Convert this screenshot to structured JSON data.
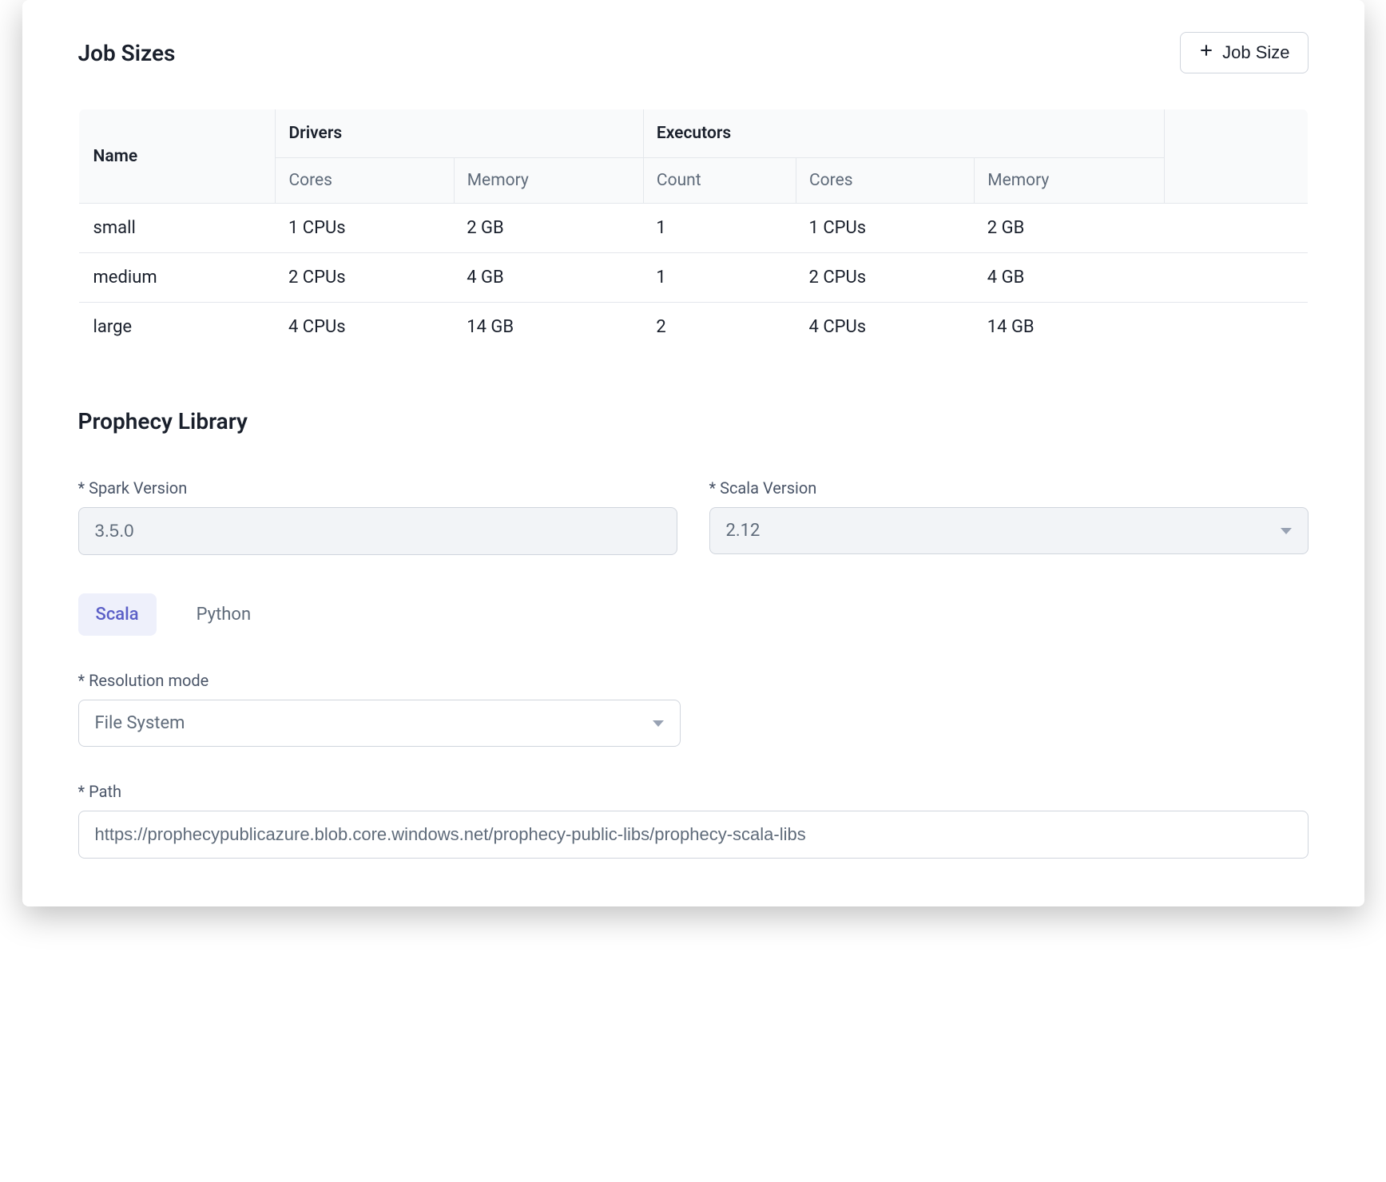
{
  "job_sizes": {
    "title": "Job Sizes",
    "add_button": "Job Size",
    "headers": {
      "name": "Name",
      "drivers": "Drivers",
      "executors": "Executors",
      "cores": "Cores",
      "memory": "Memory",
      "count": "Count"
    },
    "rows": [
      {
        "name": "small",
        "d_cores": "1 CPUs",
        "d_mem": "2 GB",
        "e_count": "1",
        "e_cores": "1 CPUs",
        "e_mem": "2 GB"
      },
      {
        "name": "medium",
        "d_cores": "2 CPUs",
        "d_mem": "4 GB",
        "e_count": "1",
        "e_cores": "2 CPUs",
        "e_mem": "4 GB"
      },
      {
        "name": "large",
        "d_cores": "4 CPUs",
        "d_mem": "14 GB",
        "e_count": "2",
        "e_cores": "4 CPUs",
        "e_mem": "14 GB"
      }
    ]
  },
  "library": {
    "title": "Prophecy Library",
    "spark_label": "* Spark Version",
    "spark_value": "3.5.0",
    "scala_label": "* Scala Version",
    "scala_value": "2.12",
    "tabs": {
      "scala": "Scala",
      "python": "Python"
    },
    "resolution_label": "* Resolution mode",
    "resolution_value": "File System",
    "path_label": "* Path",
    "path_value": "https://prophecypublicazure.blob.core.windows.net/prophecy-public-libs/prophecy-scala-libs"
  }
}
